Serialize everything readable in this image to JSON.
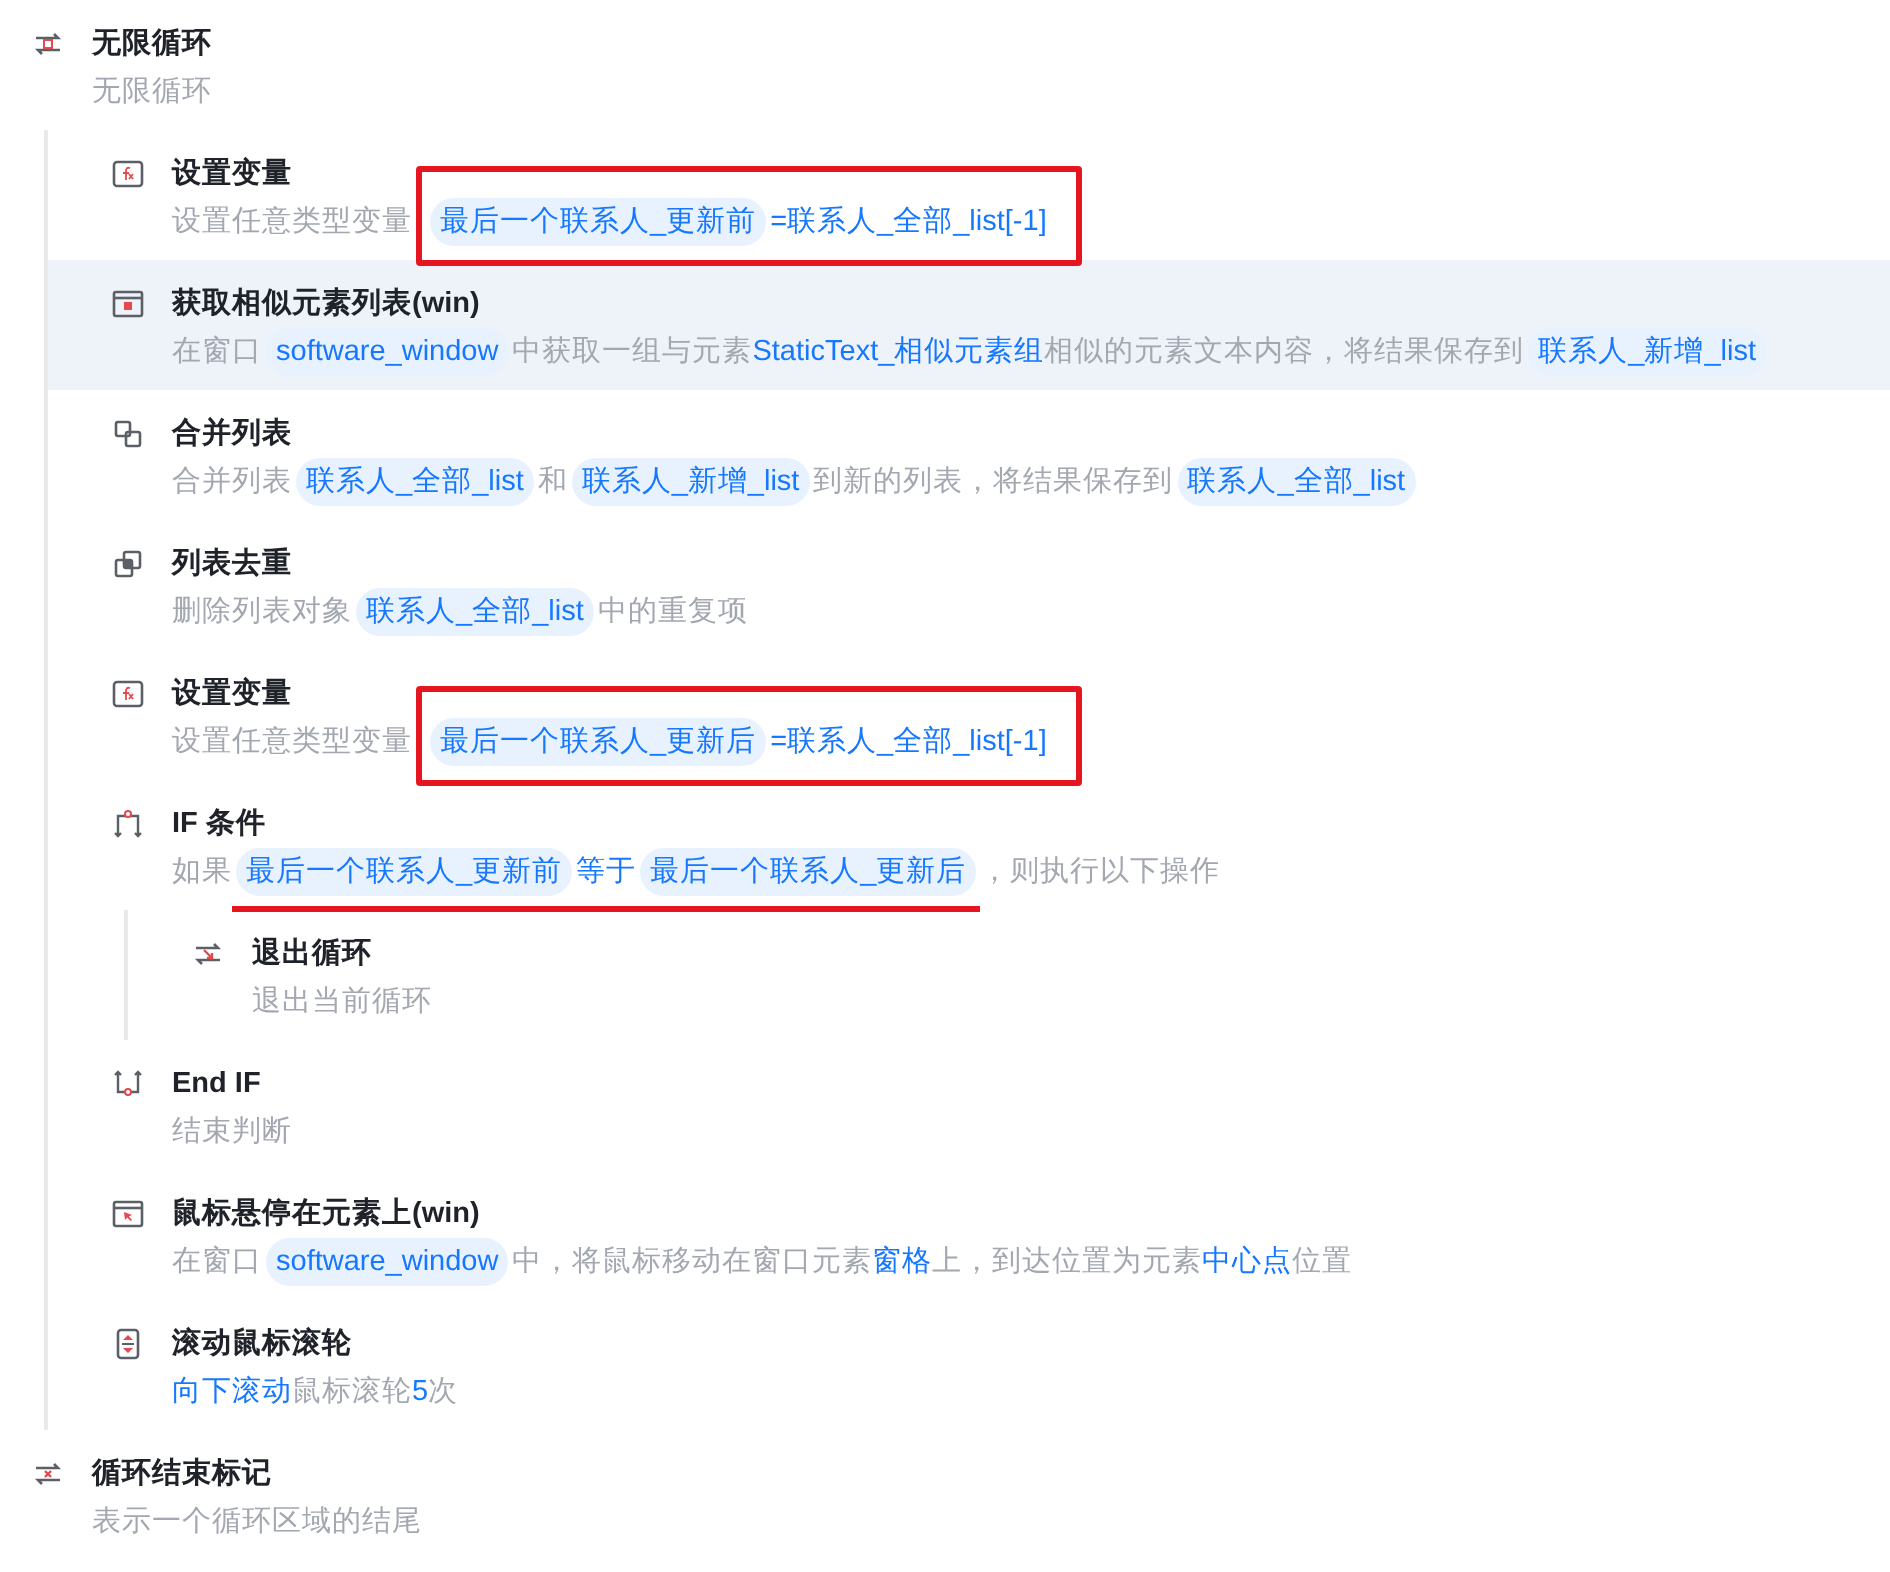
{
  "steps": [
    {
      "kind": "loop",
      "title": "无限循环",
      "selected": false,
      "desc": [
        {
          "kind": "text",
          "text": "无限循环"
        }
      ],
      "children": [
        {
          "kind": "fx",
          "title": "设置变量",
          "selected": false,
          "desc": [
            {
              "kind": "text",
              "text": "设置任意类型变量"
            },
            {
              "kind": "box",
              "items": [
                {
                  "kind": "var",
                  "text": "最后一个联系人_更新前"
                },
                {
                  "kind": "value",
                  "text": "=联系人_全部_list[-1]"
                }
              ]
            }
          ]
        },
        {
          "kind": "window",
          "title": "获取相似元素列表(win)",
          "selected": true,
          "desc": [
            {
              "kind": "text",
              "text": "在窗口"
            },
            {
              "kind": "var",
              "text": "software_window"
            },
            {
              "kind": "text",
              "text": "中获取一组与元素"
            },
            {
              "kind": "value",
              "text": "StaticText_相似元素组"
            },
            {
              "kind": "text",
              "text": "相似的元素文本内容，将结果保存到"
            },
            {
              "kind": "var",
              "text": "联系人_新增_list"
            }
          ]
        },
        {
          "kind": "merge",
          "title": "合并列表",
          "selected": false,
          "desc": [
            {
              "kind": "text",
              "text": "合并列表"
            },
            {
              "kind": "var",
              "text": "联系人_全部_list"
            },
            {
              "kind": "text",
              "text": "和"
            },
            {
              "kind": "var",
              "text": "联系人_新增_list"
            },
            {
              "kind": "text",
              "text": "到新的列表，将结果保存到"
            },
            {
              "kind": "var",
              "text": "联系人_全部_list"
            }
          ]
        },
        {
          "kind": "dedupe",
          "title": "列表去重",
          "selected": false,
          "desc": [
            {
              "kind": "text",
              "text": "删除列表对象"
            },
            {
              "kind": "var",
              "text": "联系人_全部_list"
            },
            {
              "kind": "text",
              "text": "中的重复项"
            }
          ]
        },
        {
          "kind": "fx",
          "title": "设置变量",
          "selected": false,
          "desc": [
            {
              "kind": "text",
              "text": "设置任意类型变量"
            },
            {
              "kind": "box",
              "items": [
                {
                  "kind": "var",
                  "text": "最后一个联系人_更新后"
                },
                {
                  "kind": "value",
                  "text": "=联系人_全部_list[-1]"
                }
              ]
            }
          ]
        },
        {
          "kind": "if",
          "title": "IF 条件",
          "selected": false,
          "desc": [
            {
              "kind": "text",
              "text": "如果"
            },
            {
              "kind": "underline",
              "items": [
                {
                  "kind": "var",
                  "text": "最后一个联系人_更新前"
                },
                {
                  "kind": "value",
                  "text": "等于"
                },
                {
                  "kind": "var",
                  "text": "最后一个联系人_更新后"
                }
              ]
            },
            {
              "kind": "text",
              "text": "，则执行以下操作"
            }
          ],
          "children": [
            {
              "kind": "exit",
              "title": "退出循环",
              "selected": false,
              "desc": [
                {
                  "kind": "text",
                  "text": "退出当前循环"
                }
              ]
            }
          ]
        },
        {
          "kind": "endif",
          "title": "End IF",
          "selected": false,
          "desc": [
            {
              "kind": "text",
              "text": "结束判断"
            }
          ]
        },
        {
          "kind": "hover",
          "title": "鼠标悬停在元素上(win)",
          "selected": false,
          "desc": [
            {
              "kind": "text",
              "text": "在窗口"
            },
            {
              "kind": "var",
              "text": "software_window"
            },
            {
              "kind": "text",
              "text": "中，将鼠标移动在窗口元素"
            },
            {
              "kind": "value",
              "text": "窗格"
            },
            {
              "kind": "text",
              "text": "上，到达位置为元素"
            },
            {
              "kind": "value",
              "text": "中心点"
            },
            {
              "kind": "text",
              "text": "位置"
            }
          ]
        },
        {
          "kind": "scroll",
          "title": "滚动鼠标滚轮",
          "selected": false,
          "desc": [
            {
              "kind": "value",
              "text": "向下滚动"
            },
            {
              "kind": "text",
              "text": "鼠标滚轮"
            },
            {
              "kind": "value",
              "text": "5"
            },
            {
              "kind": "text",
              "text": "次"
            }
          ]
        }
      ]
    },
    {
      "kind": "loopend",
      "title": "循环结束标记",
      "selected": false,
      "desc": [
        {
          "kind": "text",
          "text": "表示一个循环区域的结尾"
        }
      ]
    }
  ]
}
